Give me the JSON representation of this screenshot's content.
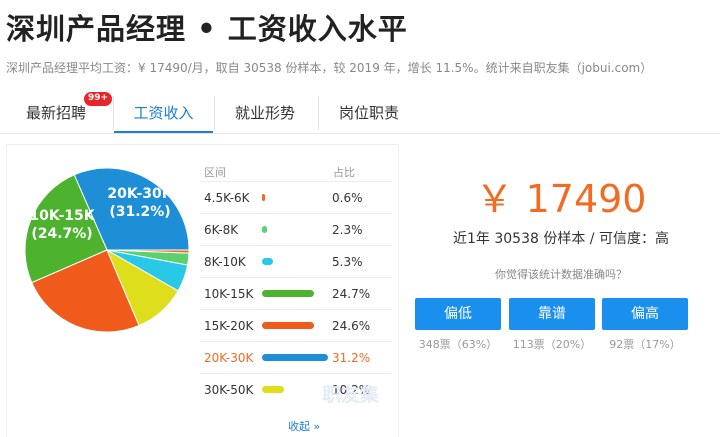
{
  "page": {
    "title": "深圳产品经理 • 工资收入水平",
    "subtitle": "深圳产品经理平均工资：¥ 17490/月，取自 30538 份样本，较 2019 年，增长 11.5%。统计来自职友集（jobui.com）"
  },
  "tabs": [
    {
      "label": "最新招聘",
      "badge": "99+"
    },
    {
      "label": "工资收入"
    },
    {
      "label": "就业形势"
    },
    {
      "label": "岗位职责"
    }
  ],
  "table": {
    "header_range": "区间",
    "header_pct": "占比",
    "rows": [
      {
        "range": "4.5K-6K",
        "pct": "0.6%"
      },
      {
        "range": "6K-8K",
        "pct": "2.3%"
      },
      {
        "range": "8K-10K",
        "pct": "5.3%"
      },
      {
        "range": "10K-15K",
        "pct": "24.7%"
      },
      {
        "range": "15K-20K",
        "pct": "24.6%"
      },
      {
        "range": "20K-30K",
        "pct": "31.2%"
      },
      {
        "range": "30K-50K",
        "pct": "10.2%"
      }
    ],
    "collapse_label": "收起 »"
  },
  "chart_data": {
    "type": "pie",
    "categories": [
      "4.5K-6K",
      "6K-8K",
      "8K-10K",
      "10K-15K",
      "15K-20K",
      "20K-30K",
      "30K-50K"
    ],
    "values": [
      0.6,
      2.3,
      5.3,
      24.7,
      24.6,
      31.2,
      10.2
    ],
    "colors": [
      "#f26b23",
      "#5bd16e",
      "#29c8e6",
      "#4db32e",
      "#f05a1a",
      "#1e8fd6",
      "#dede1c"
    ],
    "labels": [
      {
        "line1": "20K-30K",
        "line2": "(31.2%)"
      },
      {
        "line1": "10K-15K",
        "line2": "(24.7%)"
      }
    ]
  },
  "watermark": "职友集",
  "summary": {
    "salary": "￥ 17490",
    "sample": "近1年 30538 份样本 / 可信度：高",
    "question": "你觉得该统计数据准确吗？"
  },
  "votes": [
    {
      "label": "偏低",
      "count": "348票（63%）"
    },
    {
      "label": "靠谱",
      "count": "113票（20%）"
    },
    {
      "label": "偏高",
      "count": "92票（17%）"
    }
  ],
  "colors": {
    "accent": "#1a7fd6",
    "highlight": "#f26b23",
    "button": "#1a8fee"
  }
}
